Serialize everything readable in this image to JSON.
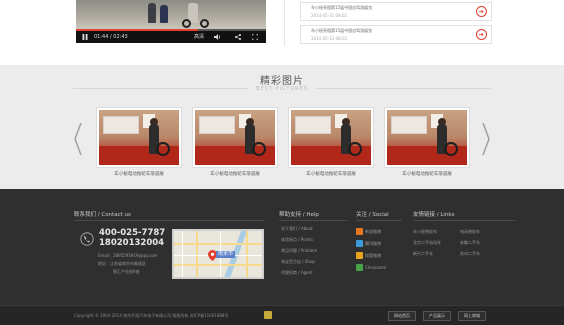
{
  "video": {
    "time": "01:44 / 02:43",
    "quality": "高清",
    "progress": 0.64
  },
  "news": [
    {
      "title": "车小秘亮相第15届中国自驾游展览",
      "date": "2014-05-31 08:02"
    },
    {
      "title": "车小秘亮相第15届中国自驾游展览",
      "date": "2014-05-31 08:02"
    }
  ],
  "gallery": {
    "title": "精彩图片",
    "subtitle": "BEST PICTURES",
    "items": [
      {
        "caption": "车小秘电动独轮车渐道展"
      },
      {
        "caption": "车小秘电动独轮车渐道展"
      },
      {
        "caption": "车小秘电动独轮车渐道展"
      },
      {
        "caption": "车小秘电动独轮车渐道展"
      }
    ]
  },
  "footer": {
    "contact": {
      "title": "联系我们 / Contact us",
      "phone1": "400-025-7787",
      "phone2": "18020132004",
      "email": "Email：2895595919@qq.com",
      "address1": "地址：江苏省南京市秦淮区",
      "address2": "智汇产业园A座",
      "map_label": "南京市"
    },
    "help": {
      "title": "帮助支持 / Help",
      "items": [
        "关于我们 / About",
        "体验网点 / Points",
        "常见问题 / Problem",
        "淘宝官方店 / Shop",
        "代理招商 / Agent"
      ]
    },
    "social": {
      "title": "关注 / Social",
      "items": [
        "新浪微博",
        "腾讯微博",
        "搜狐微博",
        "Chexiaomi"
      ],
      "icon_colors": [
        "#e8781f",
        "#3b9ad9",
        "#e8a522",
        "#47a248"
      ]
    },
    "links": {
      "title": "友情链接 / Links",
      "col1": [
        "车小秘独轮车",
        "北京二手电动车",
        "新兴二手车"
      ],
      "col2": [
        "电动独轮车",
        "安徽二手车",
        "苏州二手车"
      ]
    },
    "copyright": "Copyright © 2004-2014  南京开拓汽车电子有限公司  版权所有  苏ICP备11001888号",
    "buttons": [
      "网站首页",
      "产品展示",
      "网上商城"
    ]
  }
}
